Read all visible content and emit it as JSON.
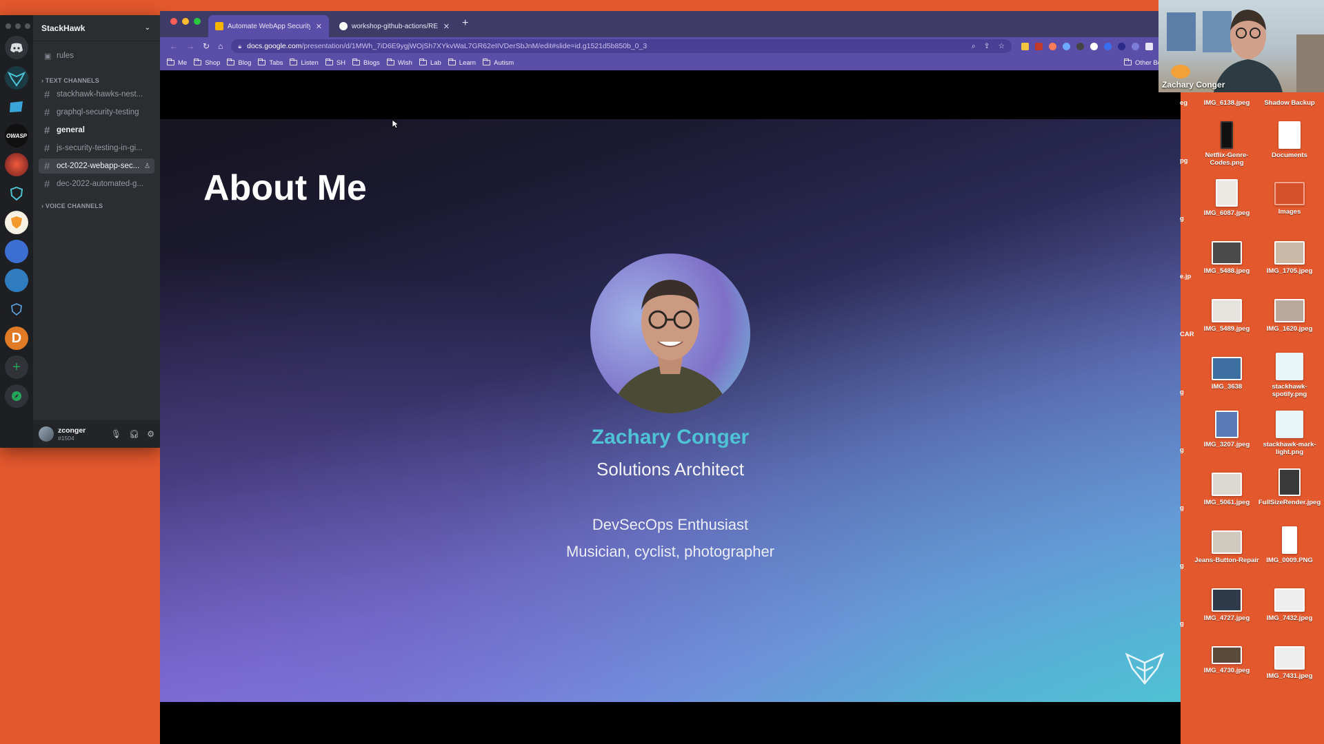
{
  "discord": {
    "server_name": "StackHawk",
    "channels_top": [
      {
        "label": "rules"
      }
    ],
    "text_category": "TEXT CHANNELS",
    "text_channels": [
      {
        "label": "stackhawk-hawks-nest..."
      },
      {
        "label": "graphql-security-testing"
      },
      {
        "label": "general"
      },
      {
        "label": "js-security-testing-in-gi..."
      },
      {
        "label": "oct-2022-webapp-sec..."
      },
      {
        "label": "dec-2022-automated-g..."
      }
    ],
    "voice_category": "VOICE CHANNELS",
    "user": {
      "name": "zconger",
      "tag": "#1504"
    }
  },
  "browser": {
    "tabs": [
      {
        "label": "Automate WebApp Security Te"
      },
      {
        "label": "workshop-github-actions/REA"
      }
    ],
    "url_host": "docs.google.com",
    "url_path": "/presentation/d/1MWh_7iD6E9ygjWOjSh7XYkvWaL7GR62eIIVDerSbJnM/edit#slide=id.g1521d5b850b_0_3",
    "bookmarks": [
      {
        "label": "Me"
      },
      {
        "label": "Shop"
      },
      {
        "label": "Blog"
      },
      {
        "label": "Tabs"
      },
      {
        "label": "Listen"
      },
      {
        "label": "SH"
      },
      {
        "label": "Blogs"
      },
      {
        "label": "Wish"
      },
      {
        "label": "Lab"
      },
      {
        "label": "Learn"
      },
      {
        "label": "Autism"
      }
    ],
    "other_bookmarks": "Other Bookm"
  },
  "slide": {
    "title": "About Me",
    "name": "Zachary Conger",
    "role": "Solutions Architect",
    "lines": [
      "DevSecOps Enthusiast",
      "Musician, cyclist, photographer"
    ]
  },
  "webcam": {
    "name": "Zachary Conger"
  },
  "desktop": {
    "partials": [
      "eg",
      "pg",
      "g",
      "e.jp",
      "CAR",
      "g",
      "g",
      "g",
      "g",
      "g"
    ],
    "col1": [
      {
        "label": "IMG_6138.jpeg"
      },
      {
        "label": "Netflix-Genre-Codes.png"
      },
      {
        "label": "IMG_6087.jpeg"
      },
      {
        "label": "IMG_5488.jpeg"
      },
      {
        "label": "IMG_5489.jpeg"
      },
      {
        "label": "IMG_3638"
      },
      {
        "label": "IMG_3207.jpeg"
      },
      {
        "label": "IMG_5061.jpeg"
      },
      {
        "label": "Jeans-Button-Repair"
      },
      {
        "label": "IMG_4727.jpeg"
      },
      {
        "label": "IMG_4730.jpeg"
      }
    ],
    "col2": [
      {
        "label": "Shadow Backup"
      },
      {
        "label": "Documents"
      },
      {
        "label": "Images"
      },
      {
        "label": "IMG_1705.jpeg"
      },
      {
        "label": "IMG_1620.jpeg"
      },
      {
        "label": "stackhawk-spotify.png"
      },
      {
        "label": "stackhawk-mark-light.png"
      },
      {
        "label": "FullSizeRender.jpeg"
      },
      {
        "label": "IMG_0009.PNG"
      },
      {
        "label": "IMG_7432.jpeg"
      },
      {
        "label": "IMG_7431.jpeg"
      }
    ]
  },
  "colors": {
    "desktop_bg": "#e4582d",
    "accent_name": "#4fc2d6",
    "chrome_frame": "#5b4ea8"
  }
}
